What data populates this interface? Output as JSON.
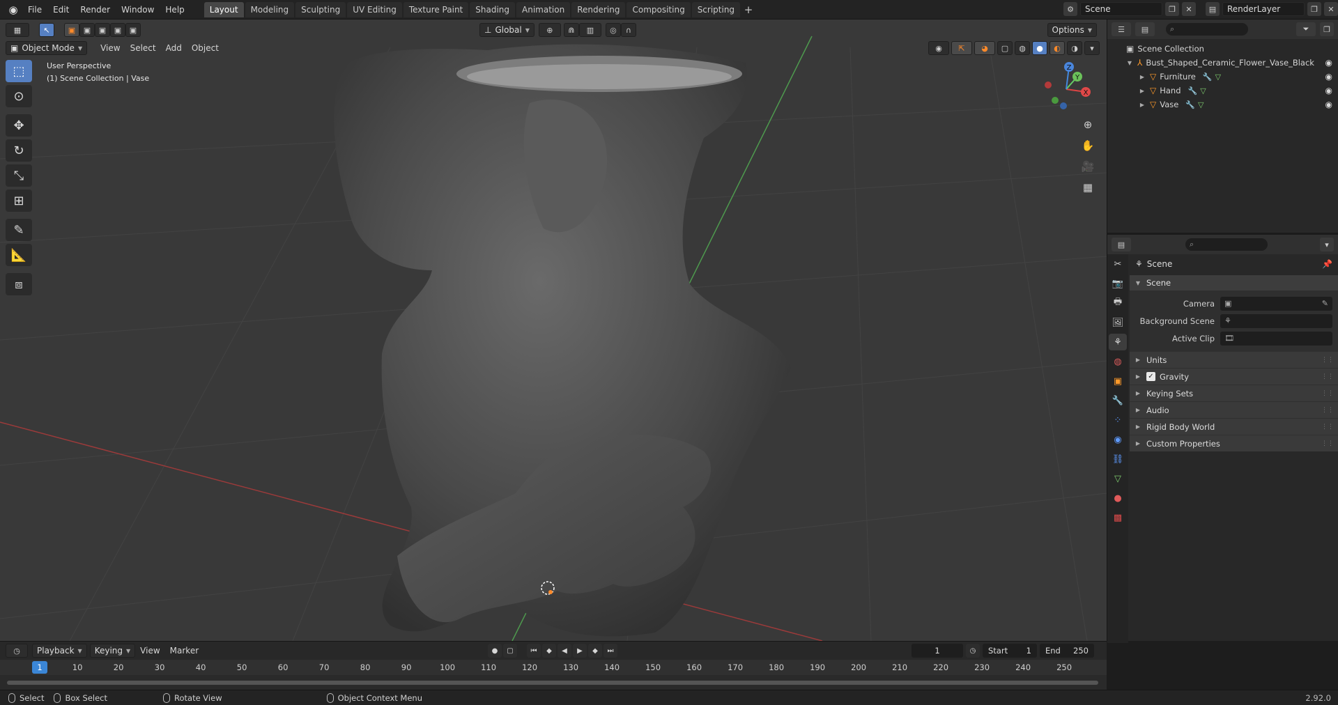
{
  "topbar": {
    "menus": [
      "File",
      "Edit",
      "Render",
      "Window",
      "Help"
    ],
    "workspaces": [
      "Layout",
      "Modeling",
      "Sculpting",
      "UV Editing",
      "Texture Paint",
      "Shading",
      "Animation",
      "Rendering",
      "Compositing",
      "Scripting"
    ],
    "active_workspace": "Layout",
    "add_workspace": "+",
    "scene": "Scene",
    "view_layer": "RenderLayer"
  },
  "viewport": {
    "mode": "Object Mode",
    "menus": [
      "View",
      "Select",
      "Add",
      "Object"
    ],
    "orientation": "Global",
    "options_label": "Options",
    "info_line1": "User Perspective",
    "info_line2": "(1) Scene Collection | Vase",
    "gizmo": {
      "x": "X",
      "y": "Y",
      "z": "Z"
    }
  },
  "outliner": {
    "root": "Scene Collection",
    "collection": "Bust_Shaped_Ceramic_Flower_Vase_Black",
    "objects": [
      "Furniture",
      "Hand",
      "Vase"
    ]
  },
  "properties": {
    "context": "Scene",
    "panel": "Scene",
    "camera_label": "Camera",
    "background_scene_label": "Background Scene",
    "active_clip_label": "Active Clip",
    "subpanels": [
      "Units",
      "Gravity",
      "Keying Sets",
      "Audio",
      "Rigid Body World",
      "Custom Properties"
    ],
    "gravity_checked": true
  },
  "timeline": {
    "menus": [
      "Playback",
      "Keying",
      "View",
      "Marker"
    ],
    "current_frame": "1",
    "start_label": "Start",
    "start": "1",
    "end_label": "End",
    "end": "250",
    "ticks": [
      "10",
      "20",
      "30",
      "40",
      "50",
      "60",
      "70",
      "80",
      "90",
      "100",
      "110",
      "120",
      "130",
      "140",
      "150",
      "160",
      "170",
      "180",
      "190",
      "200",
      "210",
      "220",
      "230",
      "240",
      "250"
    ]
  },
  "statusbar": {
    "select": "Select",
    "box_select": "Box Select",
    "rotate_view": "Rotate View",
    "context_menu": "Object Context Menu",
    "version": "2.92.0"
  },
  "colors": {
    "accent_blue": "#5680c2",
    "object_orange": "#ff9a2a",
    "frame_blue": "#3b86d6"
  }
}
